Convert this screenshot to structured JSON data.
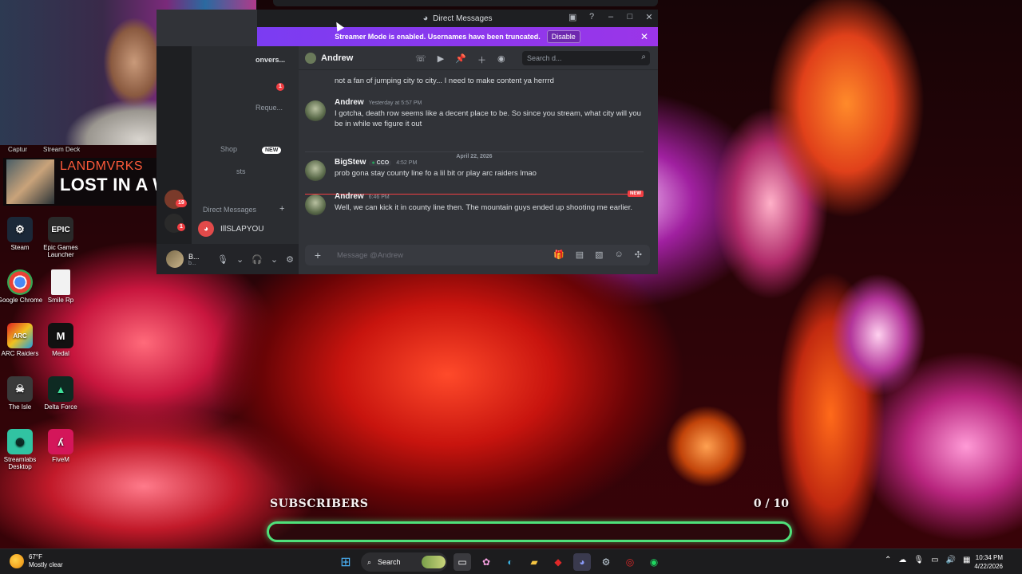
{
  "webcam": {
    "labels": [
      "Captur",
      "Stream Deck"
    ]
  },
  "now_playing": {
    "artist": "LANDMVRKS",
    "title": "LOST IN A WAVE"
  },
  "desktop_icons": [
    {
      "label": "Steam",
      "icon": "steam-icon"
    },
    {
      "label": "Epic Games Launcher",
      "icon": "epic-games-icon"
    },
    {
      "label": "Google Chrome",
      "icon": "chrome-icon"
    },
    {
      "label": "Smile Rp",
      "icon": "document-icon"
    },
    {
      "label": "ARC Raiders",
      "icon": "arc-raiders-icon"
    },
    {
      "label": "Medal",
      "icon": "medal-icon"
    },
    {
      "label": "The Isle",
      "icon": "the-isle-icon"
    },
    {
      "label": "Delta Force",
      "icon": "delta-force-icon"
    },
    {
      "label": "Streamlabs Desktop",
      "icon": "streamlabs-icon"
    },
    {
      "label": "FiveM",
      "icon": "fivem-icon"
    }
  ],
  "discord": {
    "window_title": "Direct Messages",
    "banner": {
      "text": "Streamer Mode is enabled. Usernames have been truncated.",
      "button": "Disable"
    },
    "sidebar": {
      "conversations_label": "onvers...",
      "requests_label": "Reque...",
      "requests_badge": "1",
      "shop_label": "Shop",
      "shop_badge": "NEW",
      "nitro_label": "sts",
      "guild_badges": [
        "19",
        "1"
      ],
      "dm_header": "Direct Messages",
      "dms": [
        {
          "name": "IllSLAPYOU"
        }
      ],
      "user": {
        "name": "B...",
        "status": "b..."
      }
    },
    "chat": {
      "recipient": "Andrew",
      "search_placeholder": "Search d...",
      "date_divider": "April 22, 2026",
      "new_label": "NEW",
      "composer_placeholder": "Message @Andrew",
      "messages": [
        {
          "author": "",
          "time": "",
          "text": "not a fan of jumping city to city... I need to make content ya herrrd"
        },
        {
          "author": "Andrew",
          "time": "Yesterday at 5:57 PM",
          "text": "I gotcha,  death row seems like a decent place to be. So since you stream, what city will you be in while we figure it out"
        },
        {
          "author": "BigStew",
          "role": "CCO",
          "time": "4:52 PM",
          "text": "prob gona stay county line fo a lil bit  or play arc raiders lmao"
        },
        {
          "author": "Andrew",
          "time": "6:46 PM",
          "text": "Well, we can kick it in county line then. The mountain guys ended up shooting me earlier."
        }
      ]
    }
  },
  "subscribers": {
    "label": "SUBSCRIBERS",
    "count_text": "0 / 10",
    "current": 0,
    "goal": 10,
    "accent": "#4fe07a"
  },
  "taskbar": {
    "weather_temp": "67°F",
    "weather_desc": "Mostly clear",
    "search_label": "Search",
    "time": "10:34 PM",
    "date": "4/22/2026"
  }
}
